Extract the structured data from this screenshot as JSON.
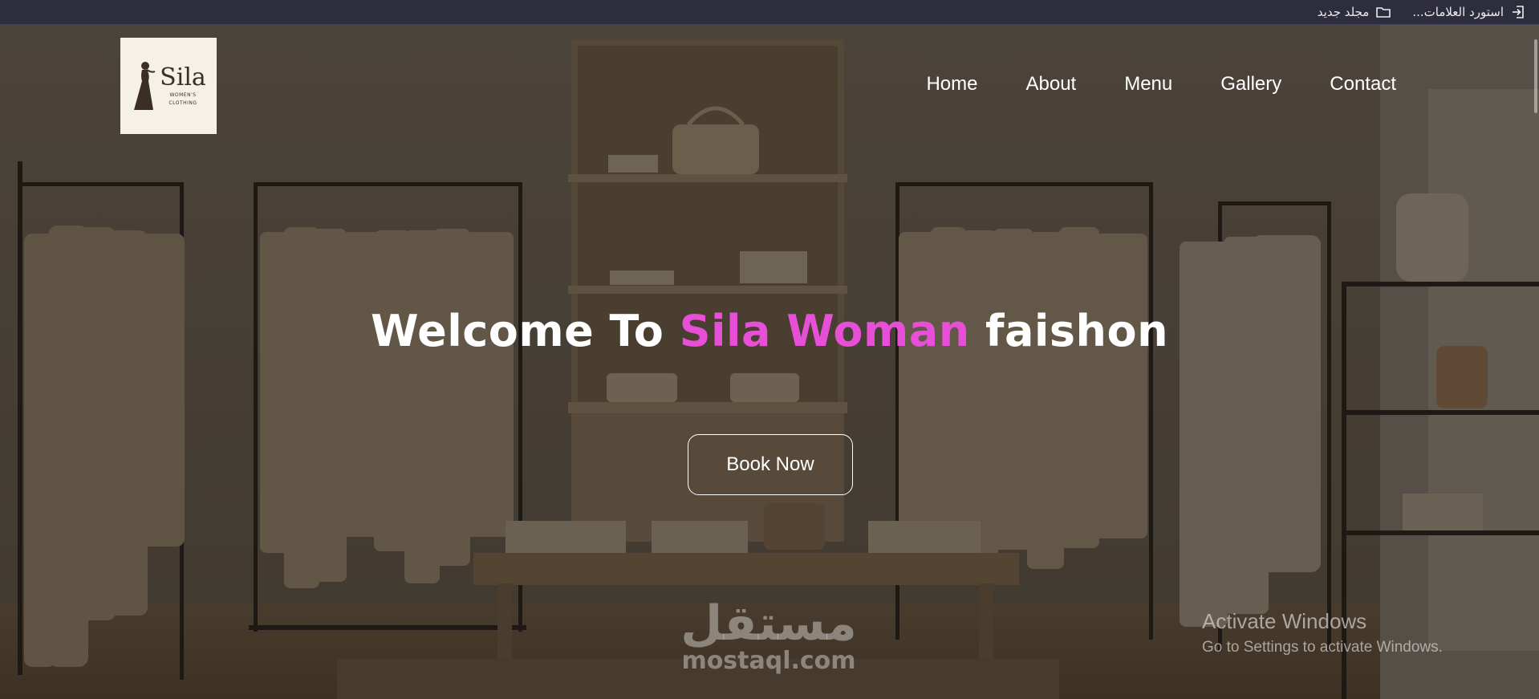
{
  "browser": {
    "bookmarks": [
      {
        "label": "استورد العلامات...",
        "icon": "import-icon"
      },
      {
        "label": "مجلد جديد",
        "icon": "folder-icon"
      }
    ]
  },
  "logo": {
    "name": "Sila",
    "subtitle_line1": "WOMEN'S",
    "subtitle_line2": "CLOTHING"
  },
  "nav": {
    "items": [
      "Home",
      "About",
      "Menu",
      "Gallery",
      "Contact"
    ]
  },
  "hero": {
    "headline_prefix": "Welcome To ",
    "headline_accent": "Sila Woman",
    "headline_suffix": " faishon",
    "button_label": "Book Now"
  },
  "watermark": {
    "arabic": "مستقل",
    "latin": "mostaql.com"
  },
  "windows_notice": {
    "title": "Activate Windows",
    "subtitle": "Go to Settings to activate Windows."
  },
  "colors": {
    "accent": "#e64fd6",
    "nav_text": "#ffffff",
    "logo_bg": "#f6f1e7"
  }
}
